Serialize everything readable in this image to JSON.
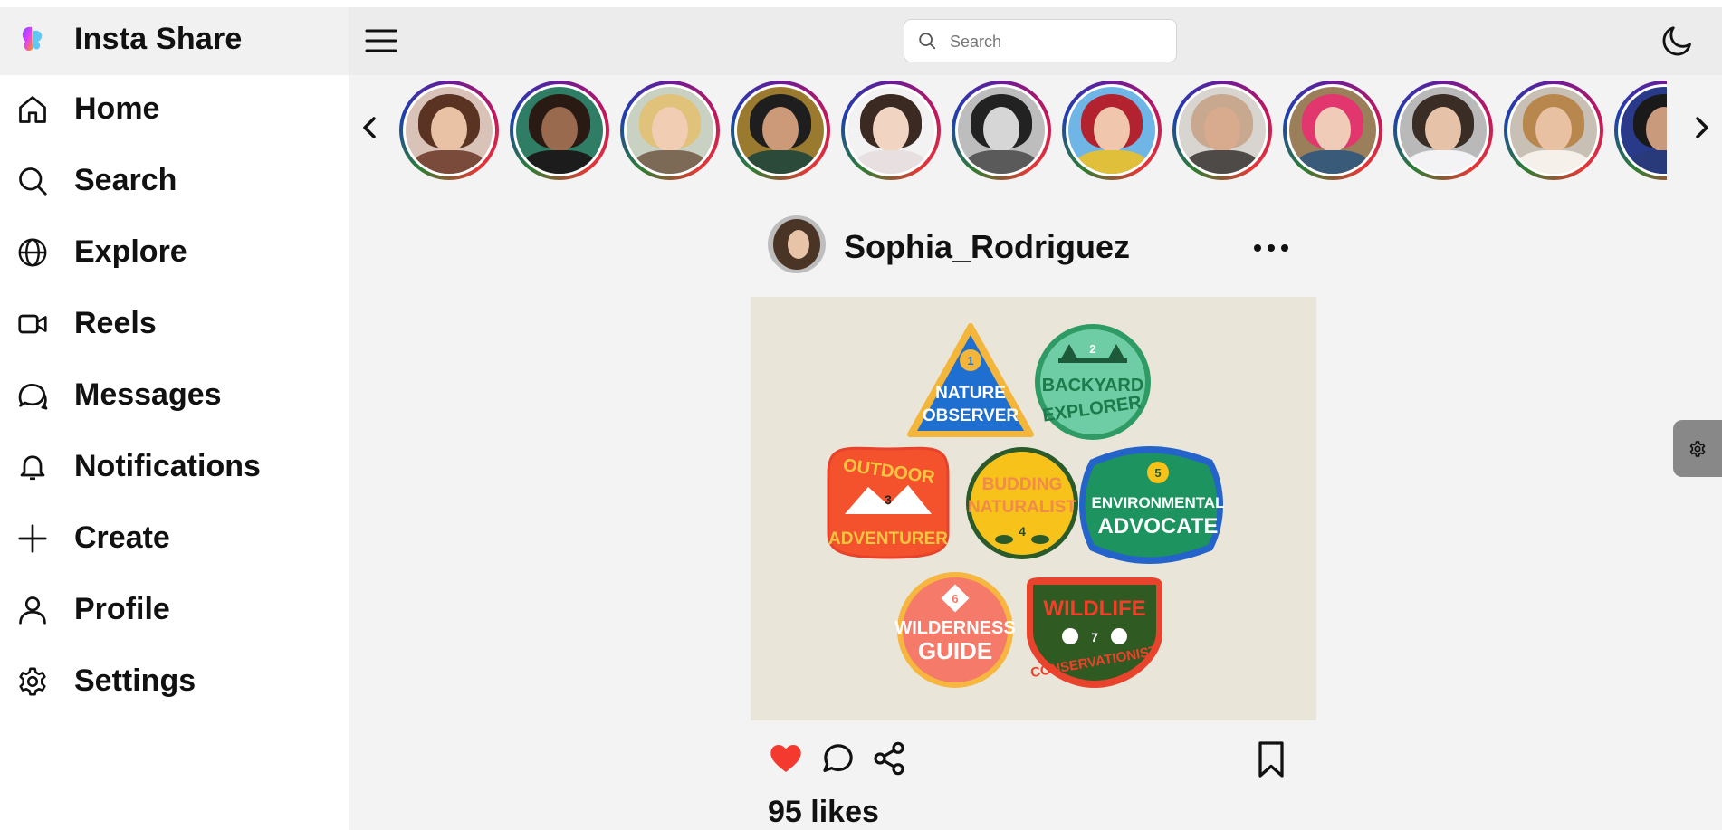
{
  "app": {
    "title": "Insta Share"
  },
  "nav": [
    {
      "label": "Home",
      "icon": "home-icon"
    },
    {
      "label": "Search",
      "icon": "search-icon"
    },
    {
      "label": "Explore",
      "icon": "globe-icon"
    },
    {
      "label": "Reels",
      "icon": "video-icon"
    },
    {
      "label": "Messages",
      "icon": "chat-icon"
    },
    {
      "label": "Notifications",
      "icon": "bell-icon"
    },
    {
      "label": "Create",
      "icon": "plus-icon"
    },
    {
      "label": "Profile",
      "icon": "user-icon"
    },
    {
      "label": "Settings",
      "icon": "gear-icon"
    }
  ],
  "search": {
    "placeholder": "Search",
    "value": ""
  },
  "stories": {
    "count": 12
  },
  "post": {
    "username": "Sophia_Rodriguez",
    "likes_text": "95 likes",
    "liked": true,
    "badges": [
      {
        "number": "1",
        "lines": [
          "NATURE",
          "OBSERVER"
        ]
      },
      {
        "number": "2",
        "lines": [
          "BACKYARD",
          "EXPLORER"
        ]
      },
      {
        "number": "3",
        "lines": [
          "OUTDOOR",
          "ADVENTURER"
        ]
      },
      {
        "number": "4",
        "lines": [
          "BUDDING",
          "NATURALIST"
        ]
      },
      {
        "number": "5",
        "lines": [
          "ENVIRONMENTAL",
          "ADVOCATE"
        ]
      },
      {
        "number": "6",
        "lines": [
          "WILDERNESS",
          "GUIDE"
        ]
      },
      {
        "number": "7",
        "lines": [
          "WILDLIFE",
          "CONSERVATIONIST"
        ]
      }
    ]
  },
  "colors": {
    "like": "#f4392f",
    "sidebar_bg": "#ffffff",
    "topbar_bg": "#ececed",
    "feed_bg": "#f3f3f4"
  }
}
